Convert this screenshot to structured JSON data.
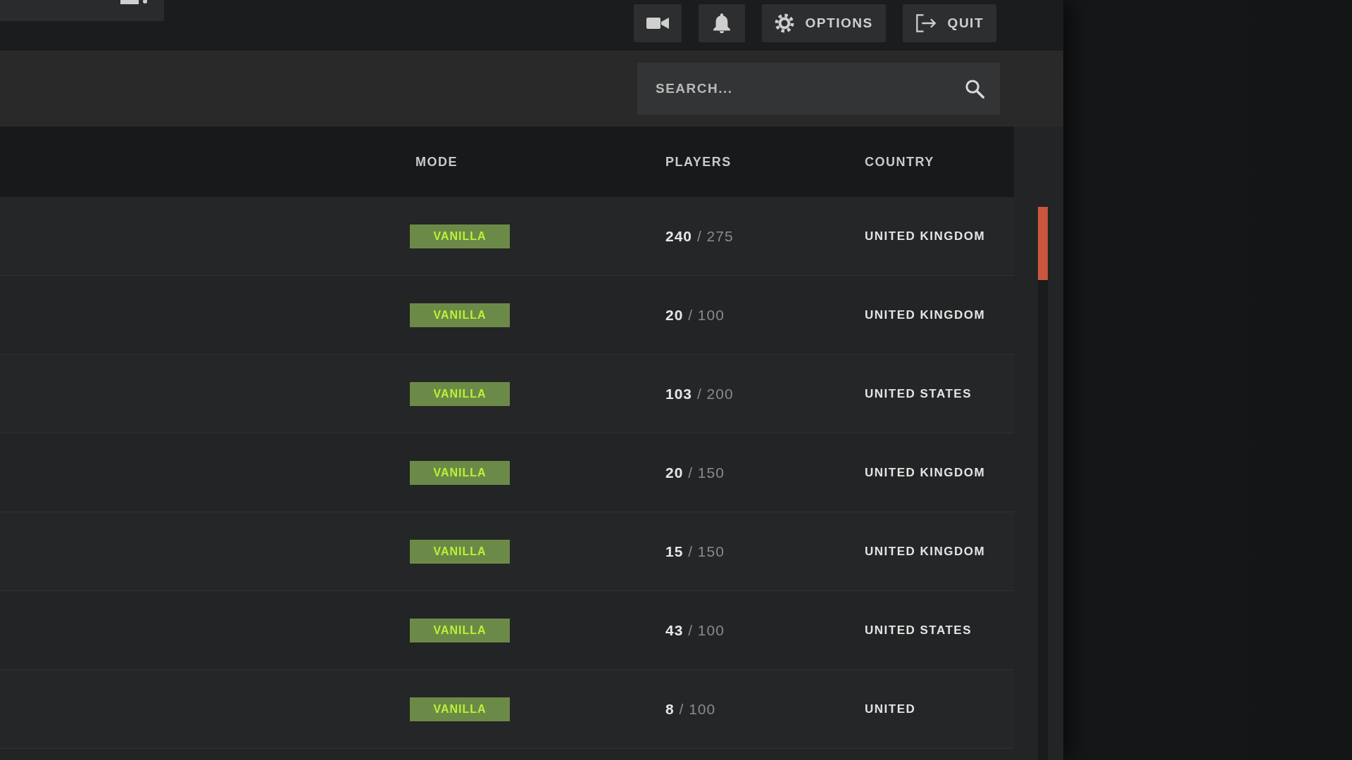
{
  "toolbar": {
    "buttons": [
      {
        "kind": "video"
      },
      {
        "kind": "notifications"
      },
      {
        "kind": "options",
        "label": "OPTIONS"
      },
      {
        "kind": "quit",
        "label": "QUIT"
      }
    ]
  },
  "search": {
    "placeholder": "SEARCH..."
  },
  "table": {
    "columns": [
      "MODE",
      "PLAYERS",
      "COUNTRY"
    ],
    "rows": [
      {
        "mode": "VANILLA",
        "players": "**240** / 275",
        "country": "UNITED KINGDOM"
      },
      {
        "mode": "VANILLA",
        "players": "**20** / 100",
        "country": "UNITED KINGDOM"
      },
      {
        "mode": "VANILLA",
        "players": "**103** / 200",
        "country": "UNITED STATES"
      },
      {
        "mode": "VANILLA",
        "players": "**20** / 150",
        "country": "UNITED KINGDOM"
      },
      {
        "mode": "VANILLA",
        "players": "**15** / 150",
        "country": "UNITED KINGDOM"
      },
      {
        "mode": "VANILLA",
        "players": "**43** / 100",
        "country": "UNITED STATES"
      },
      {
        "mode": "VANILLA",
        "players": "**8** / 100",
        "country": "UNITED"
      }
    ]
  }
}
